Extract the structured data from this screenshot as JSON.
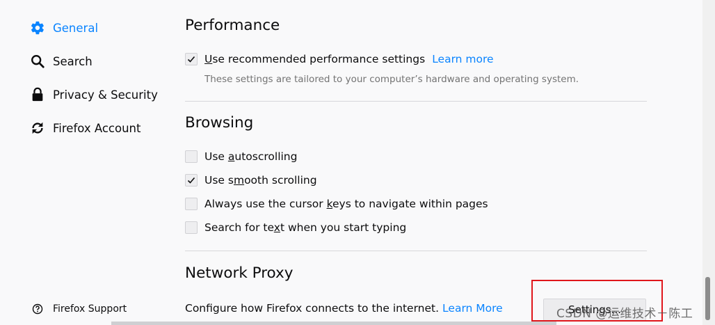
{
  "sidebar": {
    "items": [
      {
        "label": "General",
        "icon": "gear-icon"
      },
      {
        "label": "Search",
        "icon": "search-icon"
      },
      {
        "label": "Privacy & Security",
        "icon": "lock-icon"
      },
      {
        "label": "Firefox Account",
        "icon": "sync-icon"
      }
    ],
    "support_label": "Firefox Support"
  },
  "performance": {
    "title": "Performance",
    "recommended_label": "Use recommended performance settings",
    "learn_more": "Learn more",
    "description": "These settings are tailored to your computer’s hardware and operating system."
  },
  "browsing": {
    "title": "Browsing",
    "options": [
      {
        "pre": "Use ",
        "key": "a",
        "post": "utoscrolling",
        "checked": false
      },
      {
        "pre": "Use s",
        "key": "m",
        "post": "ooth scrolling",
        "checked": true
      },
      {
        "pre": "Always use the cursor ",
        "key": "k",
        "post": "eys to navigate within pages",
        "checked": false
      },
      {
        "pre": "Search for te",
        "key": "x",
        "post": "t when you start typing",
        "checked": false
      }
    ]
  },
  "network_proxy": {
    "title": "Network Proxy",
    "description": "Configure how Firefox connects to the internet.",
    "learn_more": "Learn More",
    "settings_button": "Settings..."
  },
  "watermark": "CSDN @运维技术－陈工",
  "colors": {
    "accent": "#0a84ff",
    "highlight_box": "#e0161b",
    "background": "#f9f9fa"
  }
}
